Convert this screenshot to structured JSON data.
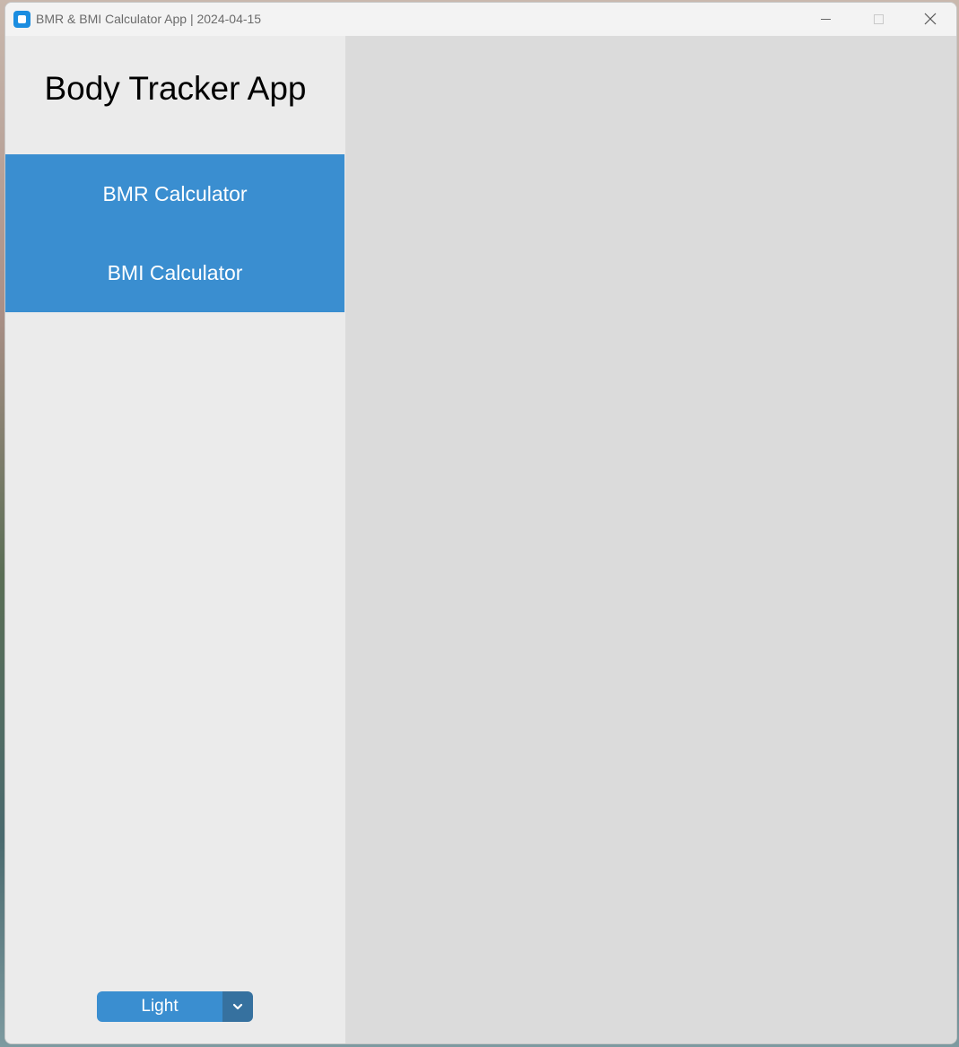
{
  "window": {
    "title": "BMR & BMI Calculator App | 2024-04-15",
    "icon": "app-icon",
    "controls": [
      "minimize-icon",
      "maximize-icon",
      "close-icon"
    ]
  },
  "sidebar": {
    "title": "Body Tracker App",
    "items": [
      {
        "label": "BMR Calculator"
      },
      {
        "label": "BMI Calculator"
      }
    ],
    "theme_select": {
      "value": "Light",
      "icon": "chevron-down-icon"
    }
  },
  "colors": {
    "accent": "#3a8ed0",
    "accent_dark": "#36719f",
    "sidebar_bg": "#ebebeb",
    "main_bg": "#dbdbdb"
  }
}
